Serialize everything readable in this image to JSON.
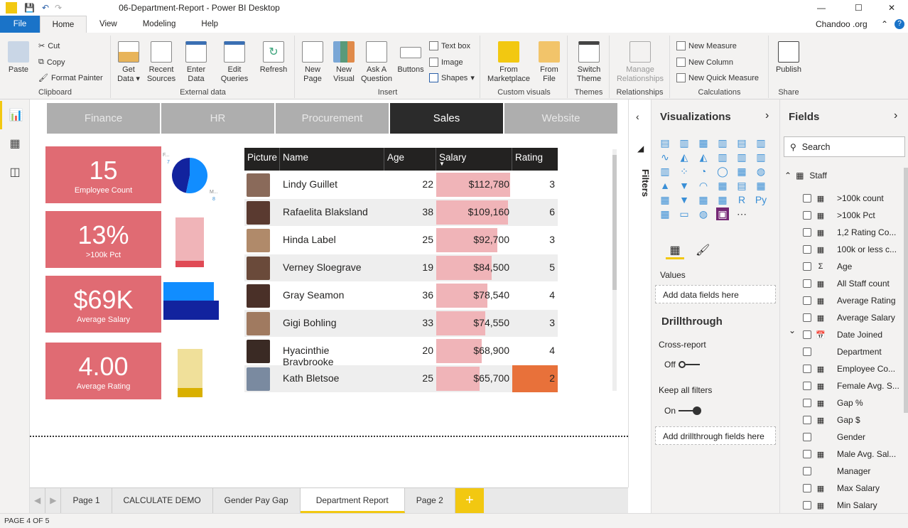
{
  "window": {
    "title": "06-Department-Report - Power BI Desktop"
  },
  "menu": {
    "tabs": [
      "File",
      "Home",
      "View",
      "Modeling",
      "Help"
    ],
    "user": "Chandoo .org"
  },
  "ribbon": {
    "clipboard": {
      "label": "Clipboard",
      "paste": "Paste",
      "cut": "Cut",
      "copy": "Copy",
      "format_painter": "Format Painter"
    },
    "external": {
      "label": "External data",
      "get_data": "Get Data",
      "recent": "Recent Sources",
      "enter": "Enter Data",
      "edit": "Edit Queries",
      "refresh": "Refresh"
    },
    "insert": {
      "label": "Insert",
      "new_page": "New Page",
      "new_visual": "New Visual",
      "ask": "Ask A Question",
      "buttons": "Buttons",
      "textbox": "Text box",
      "image": "Image",
      "shapes": "Shapes"
    },
    "custom": {
      "label": "Custom visuals",
      "marketplace": "From Marketplace",
      "file": "From File"
    },
    "themes": {
      "label": "Themes",
      "switch": "Switch Theme"
    },
    "relationships": {
      "label": "Relationships",
      "manage": "Manage Relationships"
    },
    "calc": {
      "label": "Calculations",
      "measure": "New Measure",
      "column": "New Column",
      "quick": "New Quick Measure"
    },
    "share": {
      "label": "Share",
      "publish": "Publish"
    }
  },
  "report": {
    "pages": [
      "Finance",
      "HR",
      "Procurement",
      "Sales",
      "Website"
    ],
    "selected_page": "Sales",
    "kpis": [
      {
        "value": "15",
        "label": "Employee Count"
      },
      {
        "value": "13%",
        "label": ">100k Pct"
      },
      {
        "value": "$69K",
        "label": "Average Salary"
      },
      {
        "value": "4.00",
        "label": "Average Rating"
      }
    ],
    "pie": {
      "slices": [
        {
          "label": "F...",
          "value": 7,
          "color": "#12239e"
        },
        {
          "label": "M...",
          "value": 8,
          "color": "#118dff"
        }
      ]
    },
    "table": {
      "headers": [
        "Picture",
        "Name",
        "Age",
        "Salary",
        "Rating"
      ],
      "sort_column": "Salary",
      "max_salary": 112780,
      "rows": [
        {
          "name": "Lindy Guillet",
          "age": "22",
          "salary": 112780,
          "salary_text": "$112,780",
          "rating": "3"
        },
        {
          "name": "Rafaelita Blaksland",
          "age": "38",
          "salary": 109160,
          "salary_text": "$109,160",
          "rating": "6"
        },
        {
          "name": "Hinda Label",
          "age": "25",
          "salary": 92700,
          "salary_text": "$92,700",
          "rating": "3"
        },
        {
          "name": "Verney Sloegrave",
          "age": "19",
          "salary": 84500,
          "salary_text": "$84,500",
          "rating": "5"
        },
        {
          "name": "Gray Seamon",
          "age": "36",
          "salary": 78540,
          "salary_text": "$78,540",
          "rating": "4"
        },
        {
          "name": "Gigi Bohling",
          "age": "33",
          "salary": 74550,
          "salary_text": "$74,550",
          "rating": "3"
        },
        {
          "name": "Hyacinthie Braybrooke",
          "age": "20",
          "salary": 68900,
          "salary_text": "$68,900",
          "rating": "4"
        },
        {
          "name": "Kath Bletsoe",
          "age": "25",
          "salary": 65700,
          "salary_text": "$65,700",
          "rating": "2",
          "highlight": "#e8713a"
        }
      ]
    }
  },
  "filters": {
    "label": "Filters"
  },
  "visualizations": {
    "title": "Visualizations",
    "values_label": "Values",
    "add_fields": "Add data fields here",
    "drillthrough": "Drillthrough",
    "cross_report": "Cross-report",
    "cross_state": "Off",
    "keep_filters": "Keep all filters",
    "keep_state": "On",
    "add_drill": "Add drillthrough fields here"
  },
  "fields": {
    "title": "Fields",
    "search_placeholder": "Search",
    "table": "Staff",
    "items": [
      {
        "name": ">100k count",
        "icon": "calc"
      },
      {
        "name": ">100k Pct",
        "icon": "calc"
      },
      {
        "name": "1,2 Rating Co...",
        "icon": "calc"
      },
      {
        "name": "100k or less c...",
        "icon": "calc"
      },
      {
        "name": "Age",
        "icon": "sigma"
      },
      {
        "name": "All Staff count",
        "icon": "calc"
      },
      {
        "name": "Average Rating",
        "icon": "calc"
      },
      {
        "name": "Average Salary",
        "icon": "calc"
      },
      {
        "name": "Date Joined",
        "icon": "calendar"
      },
      {
        "name": "Department",
        "icon": ""
      },
      {
        "name": "Employee Co...",
        "icon": "calc"
      },
      {
        "name": "Female Avg. S...",
        "icon": "calc"
      },
      {
        "name": "Gap %",
        "icon": "calc"
      },
      {
        "name": "Gap $",
        "icon": "calc"
      },
      {
        "name": "Gender",
        "icon": ""
      },
      {
        "name": "Male Avg. Sal...",
        "icon": "calc"
      },
      {
        "name": "Manager",
        "icon": ""
      },
      {
        "name": "Max Salary",
        "icon": "calc"
      },
      {
        "name": "Min Salary",
        "icon": "calc"
      }
    ]
  },
  "page_tabs": {
    "tabs": [
      "Page 1",
      "CALCULATE DEMO",
      "Gender Pay Gap",
      "Department Report",
      "Page 2"
    ],
    "selected": "Department Report",
    "add": "+"
  },
  "status": {
    "text": "PAGE 4 OF 5"
  }
}
